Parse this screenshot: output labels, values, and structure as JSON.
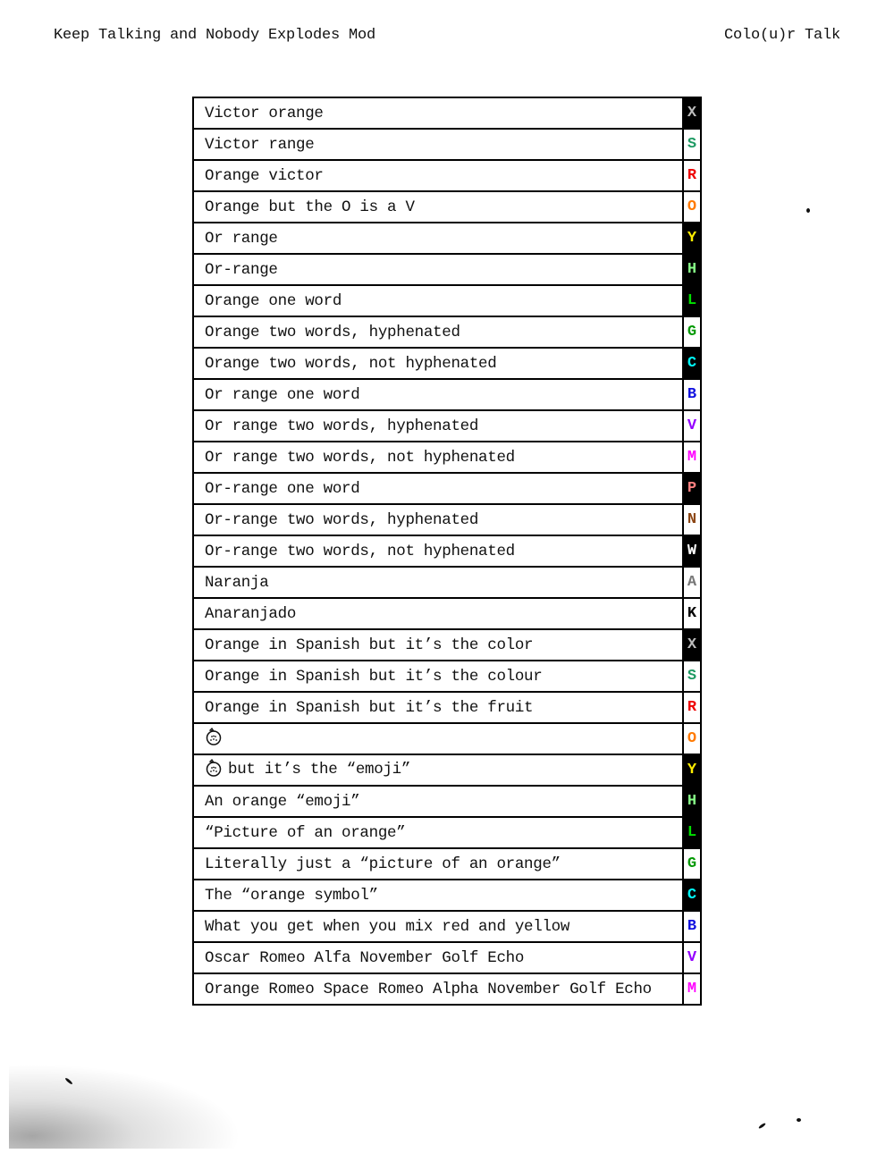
{
  "header": {
    "left": "Keep Talking and Nobody Explodes Mod",
    "right": "Colo(u)r Talk"
  },
  "colors": {
    "X": {
      "fg": "#bdbdbd",
      "bg": "#000000"
    },
    "S": {
      "fg": "#1e9a63",
      "bg": "#ffffff"
    },
    "R": {
      "fg": "#ee0000",
      "bg": "#ffffff"
    },
    "O": {
      "fg": "#ff7a00",
      "bg": "#ffffff"
    },
    "Y": {
      "fg": "#ffee00",
      "bg": "#000000"
    },
    "H": {
      "fg": "#88ff88",
      "bg": "#000000"
    },
    "L": {
      "fg": "#00e000",
      "bg": "#000000"
    },
    "G": {
      "fg": "#009900",
      "bg": "#ffffff"
    },
    "C": {
      "fg": "#00ffff",
      "bg": "#000000"
    },
    "B": {
      "fg": "#1010e0",
      "bg": "#ffffff"
    },
    "V": {
      "fg": "#9400ff",
      "bg": "#ffffff"
    },
    "M": {
      "fg": "#ff00ff",
      "bg": "#ffffff"
    },
    "P": {
      "fg": "#ff8080",
      "bg": "#000000"
    },
    "N": {
      "fg": "#8b4513",
      "bg": "#ffffff"
    },
    "W": {
      "fg": "#ffffff",
      "bg": "#000000"
    },
    "A": {
      "fg": "#777777",
      "bg": "#ffffff"
    },
    "K": {
      "fg": "#000000",
      "bg": "#ffffff"
    }
  },
  "rows": [
    {
      "text": "Victor orange",
      "code": "X"
    },
    {
      "text": "Victor range",
      "code": "S"
    },
    {
      "text": "Orange victor",
      "code": "R"
    },
    {
      "text": "Orange but the O is a V",
      "code": "O"
    },
    {
      "text": "Or range",
      "code": "Y"
    },
    {
      "text": "Or-range",
      "code": "H"
    },
    {
      "text": "Orange one word",
      "code": "L"
    },
    {
      "text": "Orange two words, hyphenated",
      "code": "G"
    },
    {
      "text": "Orange two words, not hyphenated",
      "code": "C"
    },
    {
      "text": "Or range one word",
      "code": "B"
    },
    {
      "text": "Or range two words, hyphenated",
      "code": "V"
    },
    {
      "text": "Or range two words, not hyphenated",
      "code": "M"
    },
    {
      "text": "Or-range one word",
      "code": "P"
    },
    {
      "text": "Or-range two words, hyphenated",
      "code": "N"
    },
    {
      "text": "Or-range two words, not hyphenated",
      "code": "W"
    },
    {
      "text": "Naranja",
      "code": "A"
    },
    {
      "text": "Anaranjado",
      "code": "K"
    },
    {
      "text": "Orange in Spanish but it’s the color",
      "code": "X"
    },
    {
      "text": "Orange in Spanish but it’s the colour",
      "code": "S"
    },
    {
      "text": "Orange in Spanish but it’s the fruit",
      "code": "R"
    },
    {
      "text": "",
      "icon": "orange-icon",
      "code": "O"
    },
    {
      "text": "but it’s the “emoji”",
      "icon": "orange-icon",
      "code": "Y"
    },
    {
      "text": "An orange “emoji”",
      "code": "H"
    },
    {
      "text": "“Picture of an orange”",
      "code": "L"
    },
    {
      "text": "Literally just a “picture of an orange”",
      "code": "G"
    },
    {
      "text": "The “orange symbol”",
      "code": "C"
    },
    {
      "text": "What you get when you mix red and yellow",
      "code": "B"
    },
    {
      "text": "Oscar Romeo Alfa November Golf Echo",
      "code": "V"
    },
    {
      "text": "Orange Romeo Space Romeo Alpha November Golf Echo",
      "code": "M"
    }
  ]
}
